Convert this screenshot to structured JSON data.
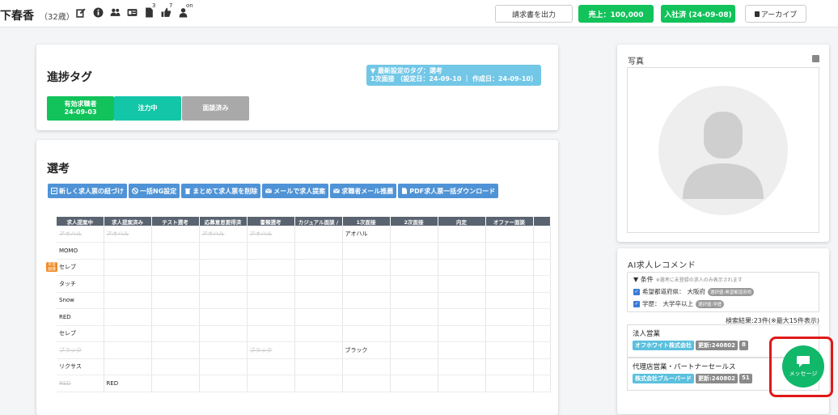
{
  "topbar": {
    "name": "下春香",
    "age": "（32歳）",
    "icons": [
      {
        "icon": "edit-icon",
        "sup": ""
      },
      {
        "icon": "info-icon",
        "sup": ""
      },
      {
        "icon": "users-icon",
        "sup": ""
      },
      {
        "icon": "id-card-icon",
        "sup": ""
      },
      {
        "icon": "document-icon",
        "sup": "3"
      },
      {
        "icon": "thumbs-up-icon",
        "sup": "7"
      },
      {
        "icon": "user-status-icon",
        "sup": "on"
      }
    ],
    "invoice_label": "請求書を出力",
    "sales_label": "売上：100,000",
    "joined_label": "入社済 (24-09-08)",
    "archive_label": "アーカイブ"
  },
  "progress": {
    "title": "進捗タグ",
    "latest_line1": "▼ 最新設定のタグ：選考",
    "latest_line2": "1次面接 （設定日：24-09-10 ｜ 作成日：24-09-10）",
    "tags": [
      {
        "line1": "有効求職者",
        "line2": "24-09-03",
        "color": "#11c35a"
      },
      {
        "line1": "注力中",
        "line2": "",
        "color": "#14c6a8"
      },
      {
        "line1": "面談済み",
        "line2": "",
        "color": "#a9a9a9"
      }
    ]
  },
  "selection": {
    "title": "選考",
    "actions": [
      {
        "label": "新しく求人票の紐づけ",
        "icon": "link-icon"
      },
      {
        "label": "一括NG設定",
        "icon": "ban-icon"
      },
      {
        "label": "まとめて求人票を削除",
        "icon": "trash-icon"
      },
      {
        "label": "メールで求人提案",
        "icon": "mail-icon"
      },
      {
        "label": "求職者メール推薦",
        "icon": "mail-icon"
      },
      {
        "label": "PDF求人票一括ダウンロード",
        "icon": "pdf-icon"
      }
    ],
    "columns": [
      "求人提案中",
      "求人提案済み",
      "テスト選考",
      "応募意思要得済",
      "書類選考",
      "カジュアル面談 / ",
      "1次面接",
      "2次面接",
      "内定",
      "オファー面談",
      ""
    ],
    "rows": [
      [
        "アオハル",
        "アオハル",
        "",
        "アオハル",
        "アオハル",
        "",
        "アオハル",
        "",
        "",
        "",
        ""
      ],
      [
        "MOMO",
        "",
        "",
        "",
        "",
        "",
        "",
        "",
        "",
        "",
        ""
      ],
      [
        "セレブ",
        "",
        "",
        "",
        "",
        "",
        "",
        "",
        "",
        "",
        ""
      ],
      [
        "タッチ",
        "",
        "",
        "",
        "",
        "",
        "",
        "",
        "",
        "",
        ""
      ],
      [
        "Snow",
        "",
        "",
        "",
        "",
        "",
        "",
        "",
        "",
        "",
        ""
      ],
      [
        "RED",
        "",
        "",
        "",
        "",
        "",
        "",
        "",
        "",
        "",
        ""
      ],
      [
        "セレブ",
        "",
        "",
        "",
        "",
        "",
        "",
        "",
        "",
        "",
        ""
      ],
      [
        "ブラック",
        "",
        "",
        "",
        "ブラック",
        "",
        "ブラック",
        "",
        "",
        "",
        ""
      ],
      [
        "リクサス",
        "",
        "",
        "",
        "",
        "",
        "",
        "",
        "",
        "",
        ""
      ],
      [
        "RED",
        "RED",
        "",
        "",
        "",
        "",
        "",
        "",
        "",
        "",
        ""
      ]
    ],
    "muted": [
      [
        true,
        true,
        false,
        true,
        true,
        false,
        false,
        false,
        false,
        false,
        false
      ],
      [
        false,
        false,
        false,
        false,
        false,
        false,
        false,
        false,
        false,
        false,
        false
      ],
      [
        false,
        false,
        false,
        false,
        false,
        false,
        false,
        false,
        false,
        false,
        false
      ],
      [
        false,
        false,
        false,
        false,
        false,
        false,
        false,
        false,
        false,
        false,
        false
      ],
      [
        false,
        false,
        false,
        false,
        false,
        false,
        false,
        false,
        false,
        false,
        false
      ],
      [
        false,
        false,
        false,
        false,
        false,
        false,
        false,
        false,
        false,
        false,
        false
      ],
      [
        false,
        false,
        false,
        false,
        false,
        false,
        false,
        false,
        false,
        false,
        false
      ],
      [
        true,
        false,
        false,
        false,
        true,
        false,
        false,
        false,
        false,
        false,
        false
      ],
      [
        false,
        false,
        false,
        false,
        false,
        false,
        false,
        false,
        false,
        false,
        false
      ],
      [
        true,
        false,
        false,
        false,
        false,
        false,
        false,
        false,
        false,
        false,
        false
      ]
    ],
    "special_badge": "本音\n面接"
  },
  "photo": {
    "title": "写真"
  },
  "ai": {
    "title": "AI求人レコメンド",
    "cond_title": "▼ 条件",
    "cond_note": "※選考に未登録の求人のみ表示されます",
    "cond1_label": "希望都道府県：",
    "cond1_value": "大阪府",
    "cond1_badge": "選択値:希望都道府県",
    "cond2_label": "学歴：",
    "cond2_value": "大学卒以上",
    "cond2_badge": "選択値:学歴",
    "results": "検索結果:23件(※最大15件表示)",
    "jobs": [
      {
        "title": "法人営業",
        "company": "オフホワイト株式会社",
        "updated": "更新:240802",
        "count": "8"
      },
      {
        "title": "代理店営業・パートナーセールス",
        "company": "株式会社ブルーバード",
        "updated": "更新:240802",
        "count": "51"
      }
    ]
  },
  "message": {
    "label": "メッセージ"
  }
}
